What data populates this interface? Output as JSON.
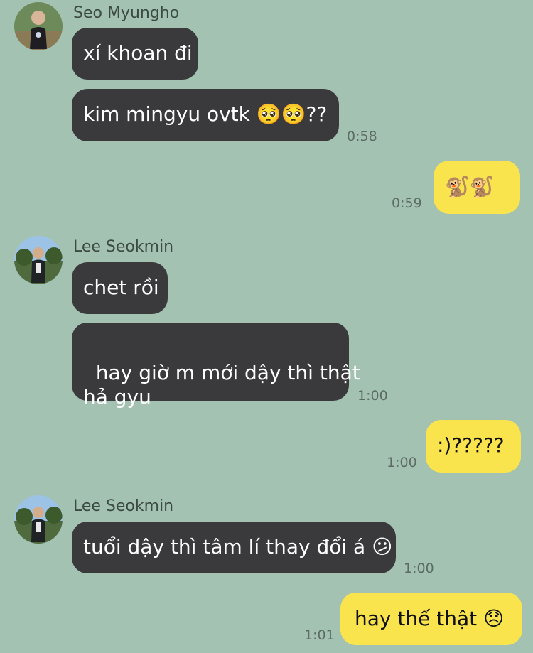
{
  "conversation": {
    "groups": [
      {
        "sender": "Seo Myungho",
        "messages": [
          {
            "text": "xí khoan đi"
          },
          {
            "text": "kim mingyu ovtk 🥺🥺??",
            "time": "0:58"
          }
        ]
      },
      {
        "sender": "me",
        "messages": [
          {
            "text": "🐒🐒",
            "time": "0:59"
          }
        ]
      },
      {
        "sender": "Lee Seokmin",
        "messages": [
          {
            "text": "chet rồi"
          },
          {
            "text": "hay giờ m mới dậy thì thật\nhả gyu",
            "time": "1:00"
          }
        ]
      },
      {
        "sender": "me",
        "messages": [
          {
            "text": ":)?????",
            "time": "1:00"
          }
        ]
      },
      {
        "sender": "Lee Seokmin",
        "messages": [
          {
            "text": "tuổi dậy thì tâm lí thay đổi á 😕",
            "time": "1:00"
          }
        ]
      },
      {
        "sender": "me",
        "messages": [
          {
            "text": "hay thế thật 😞",
            "time": "1:01"
          }
        ]
      }
    ]
  },
  "colors": {
    "background": "#a3c2b1",
    "incoming_bubble": "#3a3a3c",
    "outgoing_bubble": "#f9e44e"
  }
}
